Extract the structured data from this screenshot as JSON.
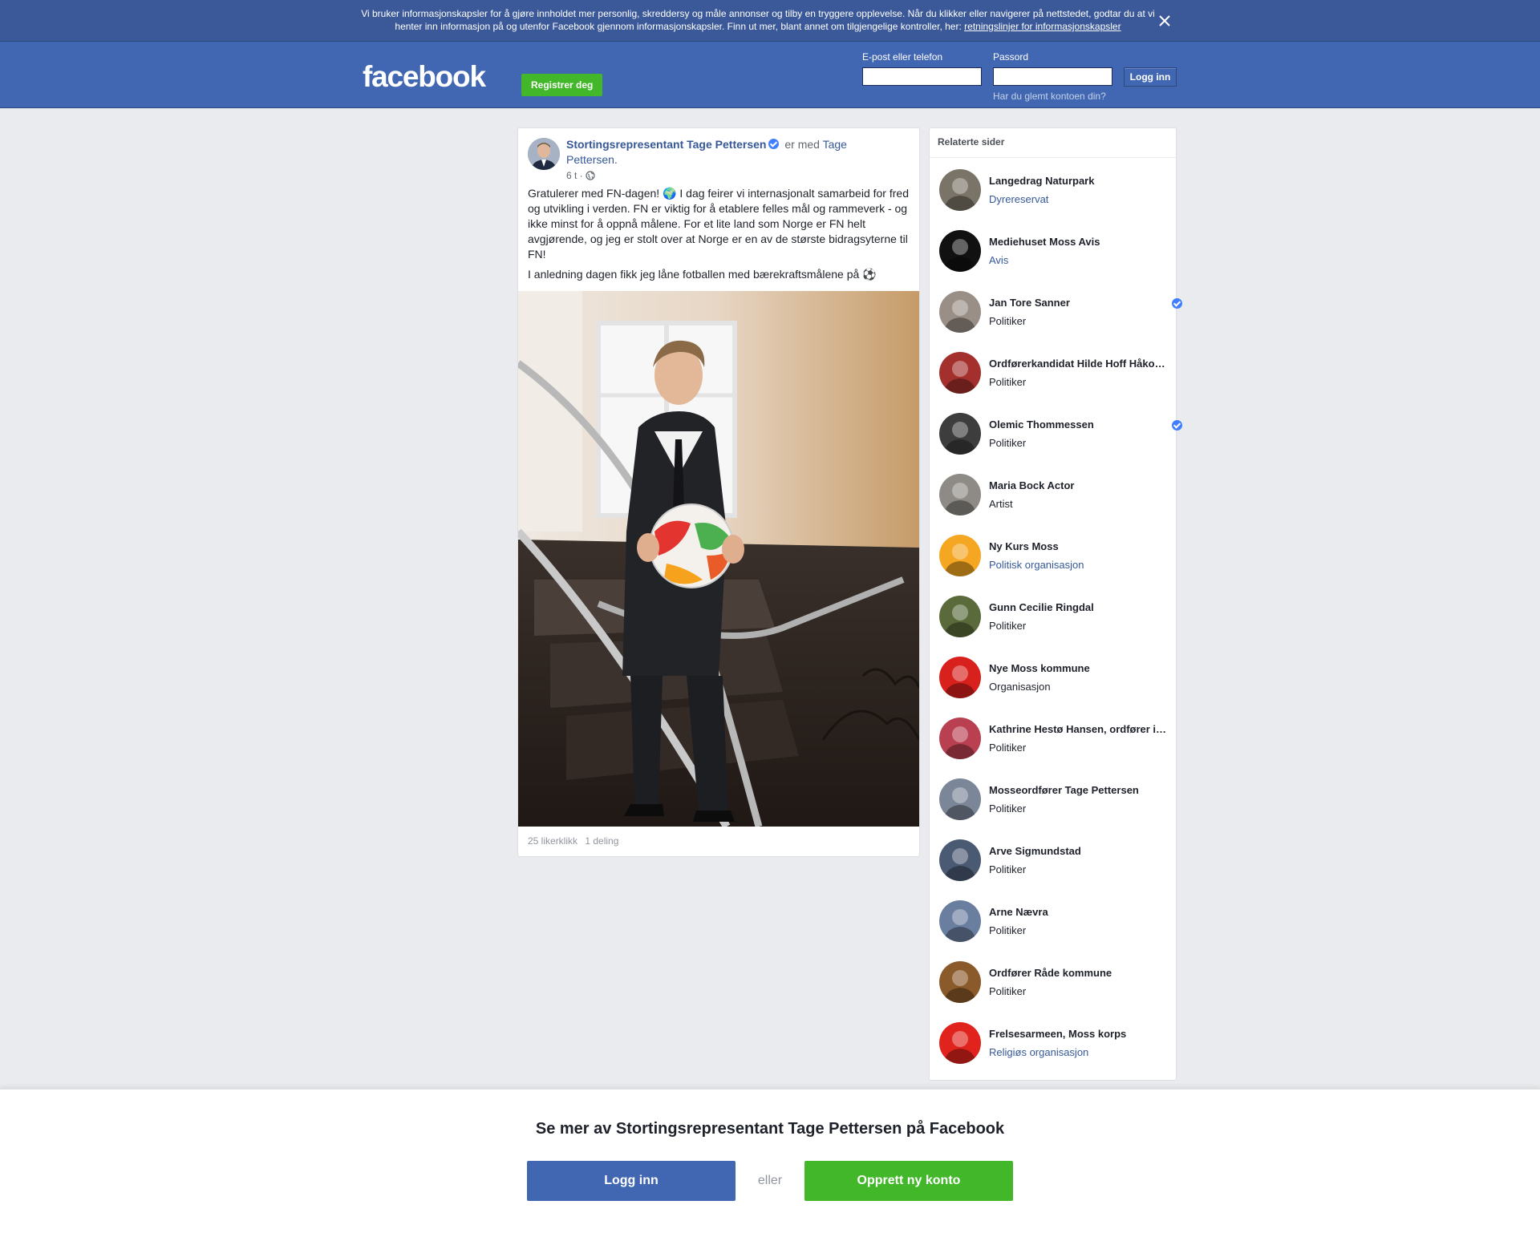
{
  "cookie_banner": {
    "text": "Vi bruker informasjonskapsler for å gjøre innholdet mer personlig, skreddersy og måle annonser og tilby en tryggere opplevelse. Når du klikker eller navigerer på nettstedet, godtar du at vi henter inn informasjon på og utenfor Facebook gjennom informasjonskapsler. Finn ut mer, blant annet om tilgjengelige kontroller, her:",
    "link": "retningslinjer for informasjonskapsler"
  },
  "header": {
    "logo": "facebook",
    "register": "Registrer deg",
    "email_label": "E-post eller telefon",
    "password_label": "Passord",
    "login": "Logg inn",
    "forgot": "Har du glemt kontoen din?"
  },
  "post": {
    "author": "Stortingsrepresentant Tage Pettersen",
    "with_text": " er med ",
    "tagged": "Tage Pettersen.",
    "time": "6 t ·",
    "body_p1": "Gratulerer med FN-dagen! 🌍 I dag feirer vi internasjonalt samarbeid for fred og utvikling i verden. FN er viktig for å etablere felles mål og rammeverk - og ikke minst for å oppnå målene. For et lite land som Norge er FN helt avgjørende, og jeg er stolt over at Norge er en av de største bidragsyterne til FN!",
    "body_p2": "I anledning dagen fikk jeg låne fotballen med bærekraftsmålene på ⚽",
    "likes": "25 likerklikk",
    "shares": "1 deling"
  },
  "related": {
    "title": "Relaterte sider",
    "items": [
      {
        "name": "Langedrag Naturpark",
        "category": "Dyrereservat",
        "link": true,
        "verified": false,
        "color": "#7a7468"
      },
      {
        "name": "Mediehuset Moss Avis",
        "category": "Avis",
        "link": true,
        "verified": false,
        "color": "#111111"
      },
      {
        "name": "Jan Tore Sanner",
        "category": "Politiker",
        "link": false,
        "verified": true,
        "color": "#9a8f86"
      },
      {
        "name": "Ordførerkandidat Hilde Hoff Håkonsen",
        "category": "Politiker",
        "link": false,
        "verified": false,
        "color": "#a3302c"
      },
      {
        "name": "Olemic Thommessen",
        "category": "Politiker",
        "link": false,
        "verified": true,
        "color": "#3d3d3d"
      },
      {
        "name": "Maria Bock Actor",
        "category": "Artist",
        "link": false,
        "verified": false,
        "color": "#8e8a85"
      },
      {
        "name": "Ny Kurs Moss",
        "category": "Politisk organisasjon",
        "link": true,
        "verified": false,
        "color": "#f5a623"
      },
      {
        "name": "Gunn Cecilie Ringdal",
        "category": "Politiker",
        "link": false,
        "verified": false,
        "color": "#5a6a3a"
      },
      {
        "name": "Nye Moss kommune",
        "category": "Organisasjon",
        "link": false,
        "verified": false,
        "color": "#d8201d"
      },
      {
        "name": "Kathrine Hestø Hansen, ordfører i Rygge",
        "category": "Politiker",
        "link": false,
        "verified": false,
        "color": "#b84050"
      },
      {
        "name": "Mosseordfører Tage Pettersen",
        "category": "Politiker",
        "link": false,
        "verified": false,
        "color": "#7b8699"
      },
      {
        "name": "Arve Sigmundstad",
        "category": "Politiker",
        "link": false,
        "verified": false,
        "color": "#4a5a72"
      },
      {
        "name": "Arne Nævra",
        "category": "Politiker",
        "link": false,
        "verified": false,
        "color": "#6a7fa0"
      },
      {
        "name": "Ordfører Råde kommune",
        "category": "Politiker",
        "link": false,
        "verified": false,
        "color": "#8a5a2a"
      },
      {
        "name": "Frelsesarmeen, Moss korps",
        "category": "Religiøs organisasjon",
        "link": true,
        "verified": false,
        "color": "#e0231d"
      }
    ]
  },
  "bottom": {
    "title": "Se mer av Stortingsrepresentant Tage Pettersen på Facebook",
    "login": "Logg inn",
    "or": "eller",
    "create": "Opprett ny konto"
  },
  "colors": {
    "brand": "#4267b2",
    "banner": "#3b5998",
    "green": "#42b72a",
    "link": "#365899"
  }
}
